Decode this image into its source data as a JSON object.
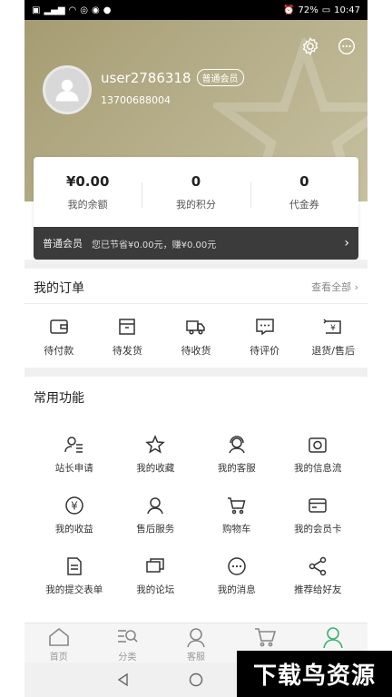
{
  "status_bar": {
    "battery": "72%",
    "time": "10:47"
  },
  "profile": {
    "username": "user2786318",
    "member_badge": "普通会员",
    "phone": "13700688004"
  },
  "stats": [
    {
      "value": "¥0.00",
      "label": "我的余额"
    },
    {
      "value": "0",
      "label": "我的积分"
    },
    {
      "value": "0",
      "label": "代金券"
    }
  ],
  "member_bar": {
    "label": "普通会员",
    "savings": "您已节省¥0.00元，赚¥0.00元"
  },
  "orders": {
    "title": "我的订单",
    "view_all": "查看全部",
    "items": [
      {
        "label": "待付款",
        "icon": "wallet-icon"
      },
      {
        "label": "待发货",
        "icon": "box-icon"
      },
      {
        "label": "待收货",
        "icon": "truck-icon"
      },
      {
        "label": "待评价",
        "icon": "comment-icon"
      },
      {
        "label": "退货/售后",
        "icon": "refund-icon"
      }
    ]
  },
  "functions": {
    "title": "常用功能",
    "items": [
      {
        "label": "站长申请",
        "icon": "person-apply-icon"
      },
      {
        "label": "我的收藏",
        "icon": "star-icon"
      },
      {
        "label": "我的客服",
        "icon": "headset-icon"
      },
      {
        "label": "我的信息流",
        "icon": "camera-icon"
      },
      {
        "label": "我的收益",
        "icon": "yen-circle-icon"
      },
      {
        "label": "售后服务",
        "icon": "service-person-icon"
      },
      {
        "label": "购物车",
        "icon": "cart-icon"
      },
      {
        "label": "我的会员卡",
        "icon": "card-icon"
      },
      {
        "label": "我的提交表单",
        "icon": "form-icon"
      },
      {
        "label": "我的论坛",
        "icon": "forum-icon"
      },
      {
        "label": "我的消息",
        "icon": "message-icon"
      },
      {
        "label": "推荐给好友",
        "icon": "share-icon"
      }
    ]
  },
  "tabs": [
    {
      "label": "首页",
      "icon": "home-icon"
    },
    {
      "label": "分类",
      "icon": "category-search-icon"
    },
    {
      "label": "客服",
      "icon": "customer-service-icon"
    },
    {
      "label": "",
      "icon": "cart-icon"
    },
    {
      "label": "",
      "icon": "profile-icon",
      "active": true
    }
  ],
  "watermark": "下载鸟资源",
  "colors": {
    "header_gold": "#b5ad88",
    "active_tab": "#3cb371",
    "member_bar": "#3b3b3b"
  }
}
